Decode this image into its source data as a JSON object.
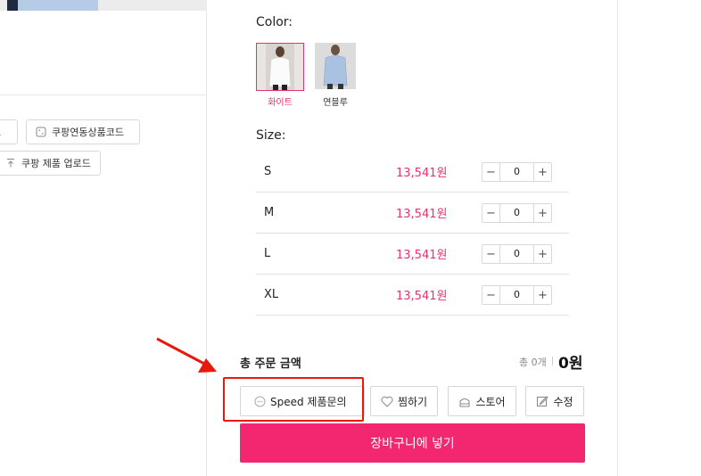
{
  "left_tools": {
    "link_label": "크",
    "linked_code_label": "쿠팡연동상품코드",
    "upload_label": "쿠팡 제품 업로드"
  },
  "color": {
    "title": "Color:",
    "options": [
      {
        "label": "화이트",
        "selected": true
      },
      {
        "label": "연블루",
        "selected": false
      }
    ]
  },
  "size": {
    "title": "Size:",
    "rows": [
      {
        "name": "S",
        "price": "13,541원",
        "qty": "0"
      },
      {
        "name": "M",
        "price": "13,541원",
        "qty": "0"
      },
      {
        "name": "L",
        "price": "13,541원",
        "qty": "0"
      },
      {
        "name": "XL",
        "price": "13,541원",
        "qty": "0"
      }
    ],
    "minus": "−",
    "plus": "+"
  },
  "total": {
    "label": "총 주문 금액",
    "count": "총 0개",
    "price": "0원"
  },
  "actions": {
    "inquiry_label": "Speed 제품문의",
    "wish_label": "찜하기",
    "store_label": "스토어",
    "edit_label": "수정",
    "cart_label": "장바구니에 넣기"
  },
  "colors": {
    "accent": "#f2276f",
    "price": "#e8326f",
    "annotation": "#e8180c"
  }
}
